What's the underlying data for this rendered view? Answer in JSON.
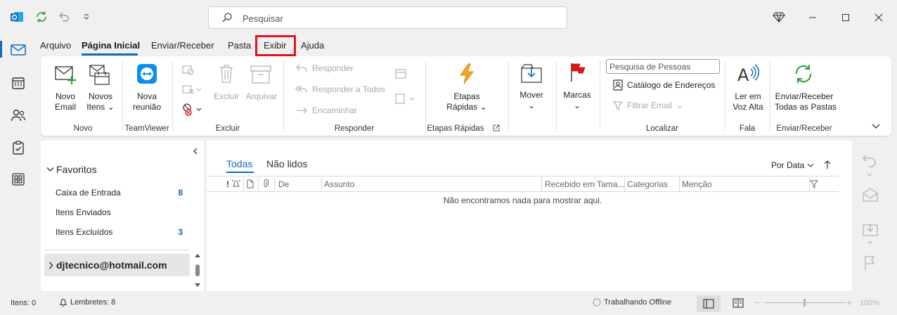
{
  "search": {
    "placeholder": "Pesquisar"
  },
  "menu": {
    "tabs": [
      "Arquivo",
      "Página Inicial",
      "Enviar/Receber",
      "Pasta",
      "Exibir",
      "Ajuda"
    ]
  },
  "ribbon": {
    "novo_email": [
      "Novo",
      "Email"
    ],
    "novos_itens": [
      "Novos",
      "Itens"
    ],
    "nova_reuniao": [
      "Nova",
      "reunião"
    ],
    "excluir": "Excluir",
    "arquivar": "Arquivar",
    "responder": "Responder",
    "responder_todos": "Responder a Todos",
    "encaminhar": "Encaminhar",
    "etapas_rapidas": [
      "Etapas",
      "Rápidas"
    ],
    "mover": "Mover",
    "marcas": "Marcas",
    "pesquisa_pessoas": "Pesquisa de Pessoas",
    "catalogo": "Catálogo de Endereços",
    "filtrar_email": "Filtrar Email",
    "ler_voz": [
      "Ler em",
      "Voz Alta"
    ],
    "enviar_receber": [
      "Enviar/Receber",
      "Todas as Pastas"
    ],
    "groups": {
      "novo": "Novo",
      "teamviewer": "TeamViewer",
      "excluir": "Excluir",
      "responder": "Responder",
      "etapas": "Etapas Rápidas",
      "localizar": "Localizar",
      "fala": "Fala",
      "enviar": "Enviar/Receber"
    }
  },
  "folders": {
    "favorites_label": "Favoritos",
    "items": [
      {
        "name": "Caixa de Entrada",
        "count": "8"
      },
      {
        "name": "Itens Enviados",
        "count": ""
      },
      {
        "name": "Itens Excluídos",
        "count": "3"
      }
    ],
    "account": "djtecnico@hotmail.com"
  },
  "list": {
    "filter_all": "Todas",
    "filter_unread": "Não lidos",
    "sort": "Por Data",
    "columns": [
      "!",
      "De",
      "Assunto",
      "Recebido em",
      "Tama...",
      "Categorias",
      "Menção"
    ],
    "empty": "Não encontramos nada para mostrar aqui."
  },
  "status": {
    "items": "Itens: 0",
    "reminders": "Lembretes: 8",
    "offline": "Trabalhando Offline",
    "zoom": "100%"
  },
  "colors": {
    "accent": "#0f6cbd",
    "highlight": "#e0141e"
  }
}
